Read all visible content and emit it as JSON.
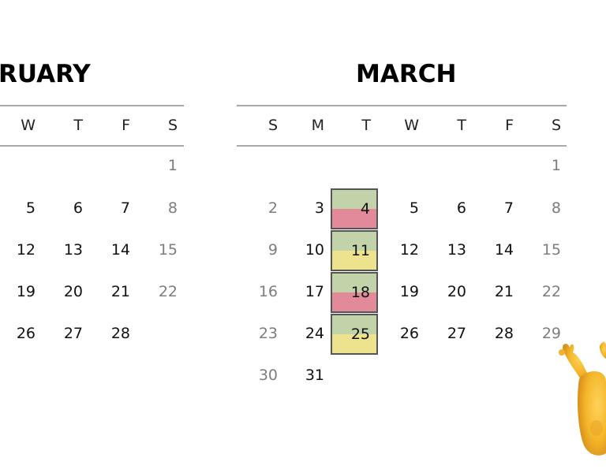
{
  "february": {
    "title": "RUARY",
    "weekdays": [
      "W",
      "T",
      "F",
      "S"
    ],
    "weeks": [
      [
        "",
        "",
        "",
        "1"
      ],
      [
        "5",
        "6",
        "7",
        "8"
      ],
      [
        "12",
        "13",
        "14",
        "15"
      ],
      [
        "19",
        "20",
        "21",
        "22"
      ],
      [
        "26",
        "27",
        "28",
        ""
      ]
    ]
  },
  "march": {
    "title": "MARCH",
    "weekdays": [
      "S",
      "M",
      "T",
      "W",
      "T",
      "F",
      "S"
    ],
    "weeks": [
      [
        "",
        "",
        "",
        "",
        "",
        "",
        "1"
      ],
      [
        "2",
        "3",
        "4",
        "5",
        "6",
        "7",
        "8"
      ],
      [
        "9",
        "10",
        "11",
        "12",
        "13",
        "14",
        "15"
      ],
      [
        "16",
        "17",
        "18",
        "19",
        "20",
        "21",
        "22"
      ],
      [
        "23",
        "24",
        "25",
        "26",
        "27",
        "28",
        "29"
      ],
      [
        "30",
        "31",
        "",
        "",
        "",
        "",
        ""
      ]
    ],
    "highlighted_days": [
      {
        "day": "4",
        "top_color": "#c3d3a9",
        "bottom_color": "#e38a9a"
      },
      {
        "day": "11",
        "top_color": "#c3d3a9",
        "bottom_color": "#ede28d"
      },
      {
        "day": "18",
        "top_color": "#c3d3a9",
        "bottom_color": "#e38a9a"
      },
      {
        "day": "25",
        "top_color": "#c3d3a9",
        "bottom_color": "#ede28d"
      }
    ]
  },
  "colors": {
    "weekend_text": "#7d7d7d",
    "rule": "#a8a8a8",
    "highlight_border": "#555555"
  },
  "mascot": {
    "name": "yellow-character-illustration"
  }
}
